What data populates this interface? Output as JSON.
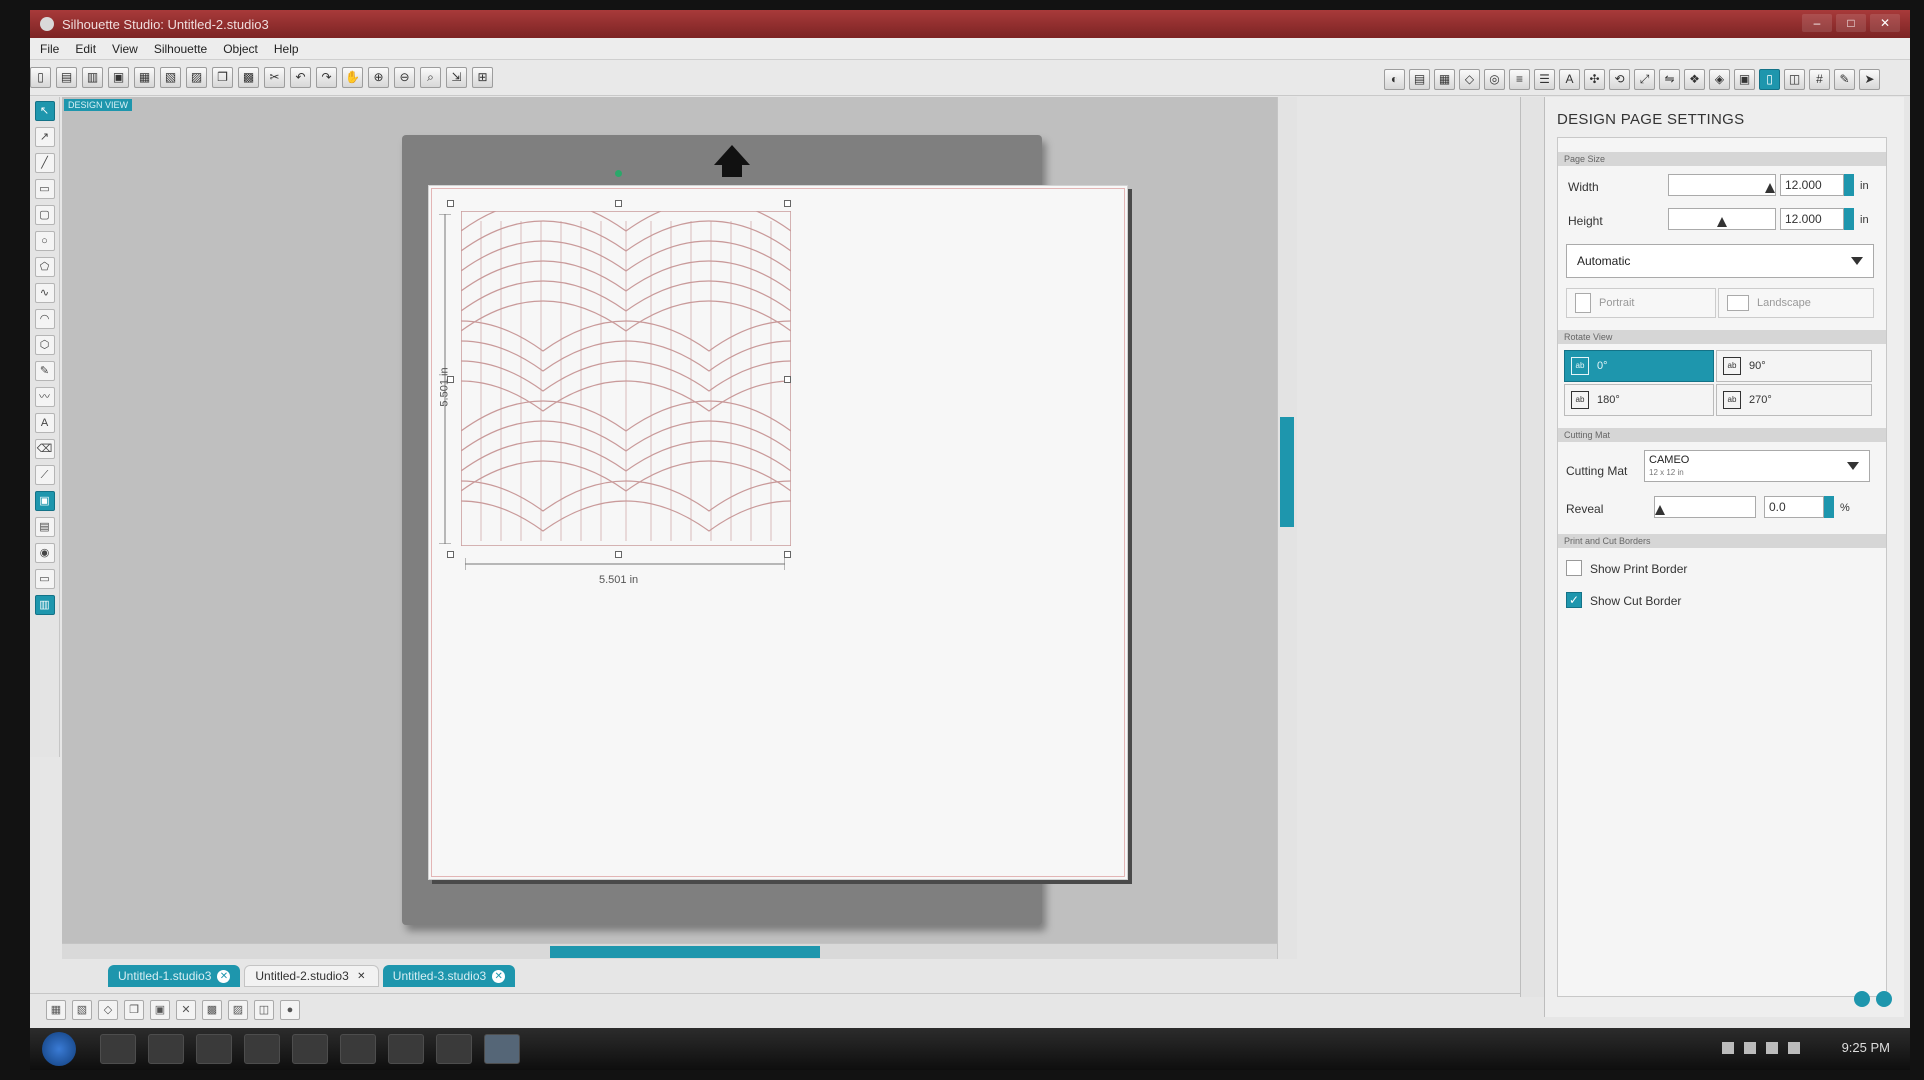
{
  "window": {
    "title": "Silhouette Studio: Untitled-2.studio3",
    "controls": [
      "–",
      "□",
      "✕"
    ]
  },
  "menu": [
    "File",
    "Edit",
    "View",
    "Silhouette",
    "Object",
    "Help"
  ],
  "canvas": {
    "view_label": "DESIGN VIEW",
    "width_dimension": "5.501 in",
    "height_dimension": "5.501 in"
  },
  "tabs": [
    {
      "label": "Untitled-1.studio3",
      "active": false
    },
    {
      "label": "Untitled-2.studio3",
      "active": true
    },
    {
      "label": "Untitled-3.studio3",
      "active": false
    }
  ],
  "panel": {
    "title": "DESIGN PAGE SETTINGS",
    "page_size": {
      "header": "Page Size",
      "width_label": "Width",
      "width_value": "12.000",
      "height_label": "Height",
      "height_value": "12.000",
      "unit": "in",
      "size_preset": "Automatic",
      "portrait": "Portrait",
      "landscape": "Landscape"
    },
    "rotate_view": {
      "header": "Rotate View",
      "options": [
        "0°",
        "90°",
        "180°",
        "270°"
      ],
      "selected": "0°"
    },
    "cutting_mat": {
      "header": "Cutting Mat",
      "label": "Cutting Mat",
      "value": "CAMEO",
      "sub": "12 x 12 in",
      "reveal_label": "Reveal",
      "reveal_value": "0.0",
      "reveal_unit": "%"
    },
    "borders": {
      "header": "Print and Cut Borders",
      "show_print_border": "Show Print Border",
      "show_print_border_checked": false,
      "show_cut_border": "Show Cut Border",
      "show_cut_border_checked": true
    }
  },
  "taskbar": {
    "clock": "9:25 PM"
  },
  "colors": {
    "accent": "#1e96ad",
    "titlebar": "#8f2e2e",
    "pattern_stroke": "#c99a9a"
  }
}
